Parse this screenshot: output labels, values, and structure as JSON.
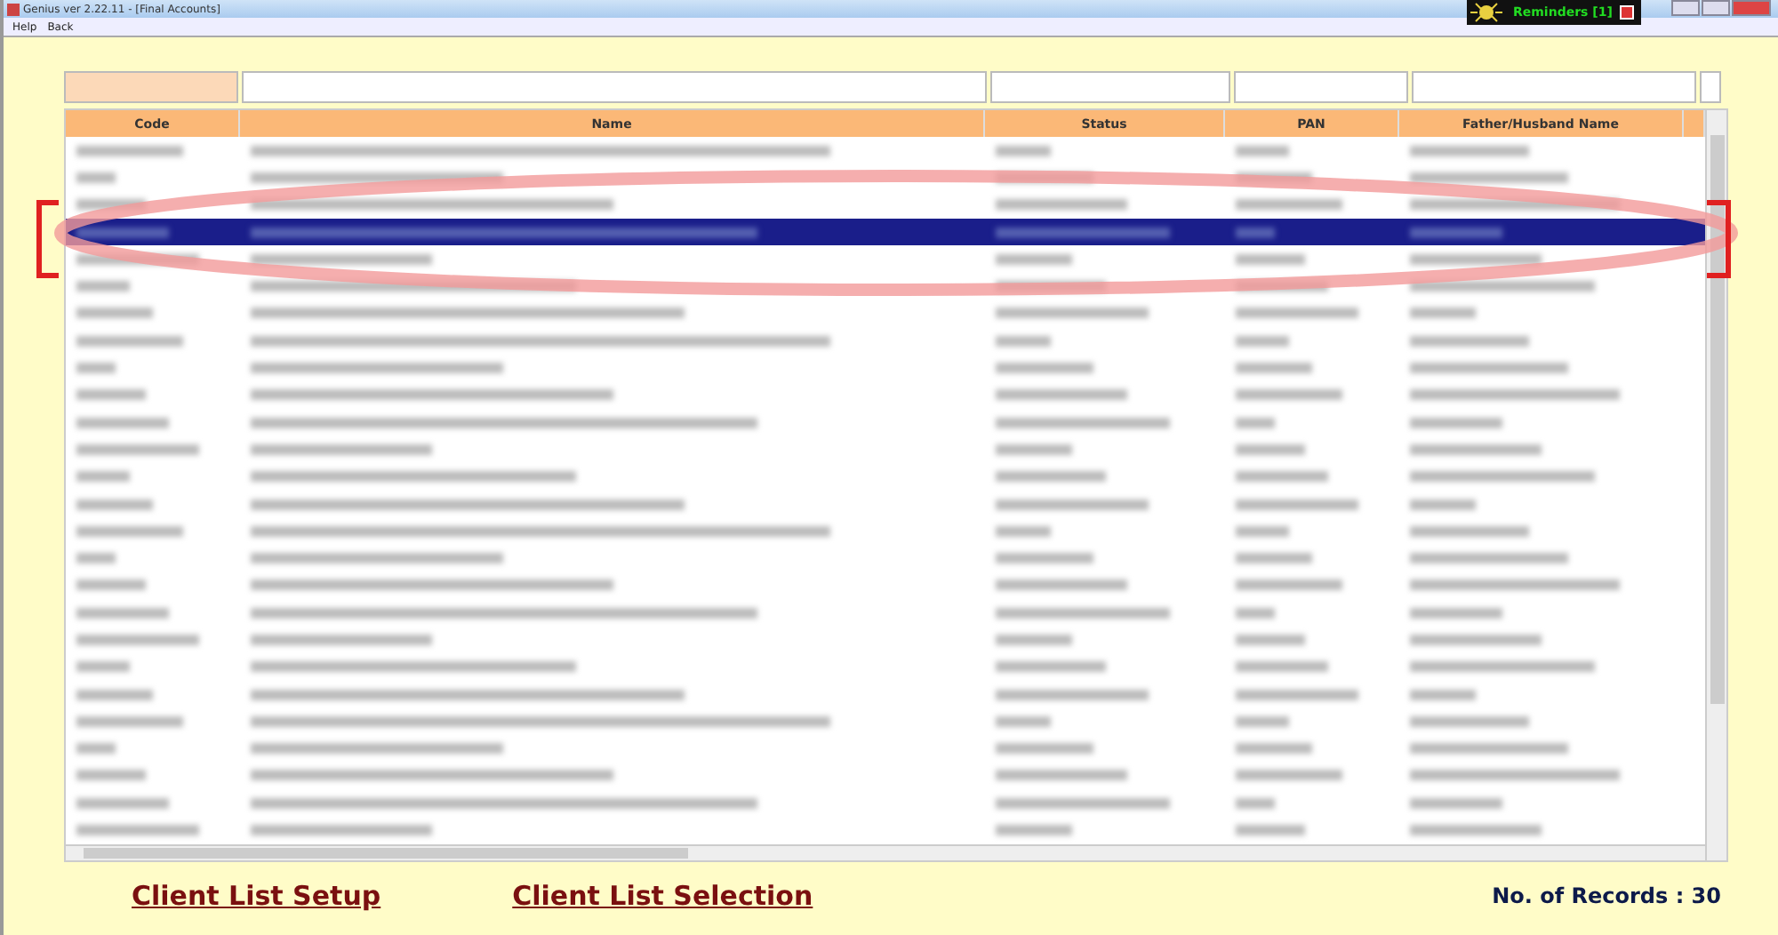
{
  "window": {
    "title": "Genius ver 2.22.11 - [Final Accounts]"
  },
  "menu": [
    "Help",
    "Back"
  ],
  "reminders": {
    "label": "Reminders [1]"
  },
  "table": {
    "columns": [
      "Code",
      "Name",
      "Status",
      "PAN",
      "Father/Husband Name"
    ],
    "rows": [
      {
        "selected": false
      },
      {
        "selected": false
      },
      {
        "selected": false
      },
      {
        "selected": true
      },
      {
        "selected": false
      },
      {
        "selected": false
      },
      {
        "selected": false
      },
      {
        "selected": false
      },
      {
        "selected": false
      },
      {
        "selected": false
      },
      {
        "selected": false
      },
      {
        "selected": false
      },
      {
        "selected": false
      },
      {
        "selected": false
      },
      {
        "selected": false
      },
      {
        "selected": false
      },
      {
        "selected": false
      },
      {
        "selected": false
      },
      {
        "selected": false
      },
      {
        "selected": false
      },
      {
        "selected": false
      },
      {
        "selected": false
      },
      {
        "selected": false
      },
      {
        "selected": false
      },
      {
        "selected": false
      },
      {
        "selected": false
      }
    ]
  },
  "links": [
    "Client List Setup",
    "Client List Selection"
  ],
  "record_count": "No. of Records : 30"
}
